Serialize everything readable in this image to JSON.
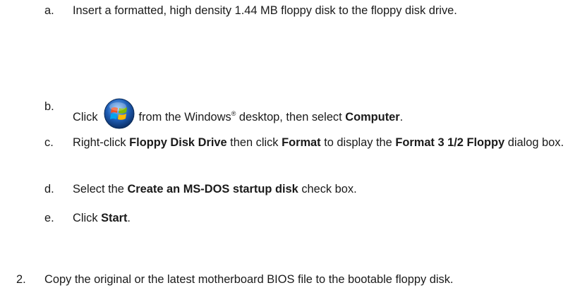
{
  "steps": {
    "a": {
      "marker": "a.",
      "text": "Insert a formatted, high density 1.44 MB floppy disk to the floppy disk drive."
    },
    "b": {
      "marker": "b.",
      "pre": "Click",
      "icon": "windows-start-icon",
      "mid": "from the Windows",
      "reg": "®",
      "mid2": "desktop, then select",
      "bold": "Computer",
      "end": "."
    },
    "c": {
      "marker": "c.",
      "t1": "Right-click",
      "b1": "Floppy Disk Drive",
      "t2": "then click",
      "b2": "Format",
      "t3": "to display the",
      "b3": "Format 3 1/2 Floppy",
      "t4": "dialog box."
    },
    "d": {
      "marker": "d.",
      "t1": "Select the",
      "b1": "Create an MS-DOS startup disk",
      "t2": "check box."
    },
    "e": {
      "marker": "e.",
      "t1": "Click",
      "b1": "Start",
      "t2": "."
    },
    "step2": {
      "marker": "2.",
      "text": "Copy the original or the latest motherboard BIOS file to the bootable floppy disk."
    }
  },
  "colors": {
    "text": "#1a1a1a",
    "windows_orb_blue": "#1f5fb8"
  }
}
